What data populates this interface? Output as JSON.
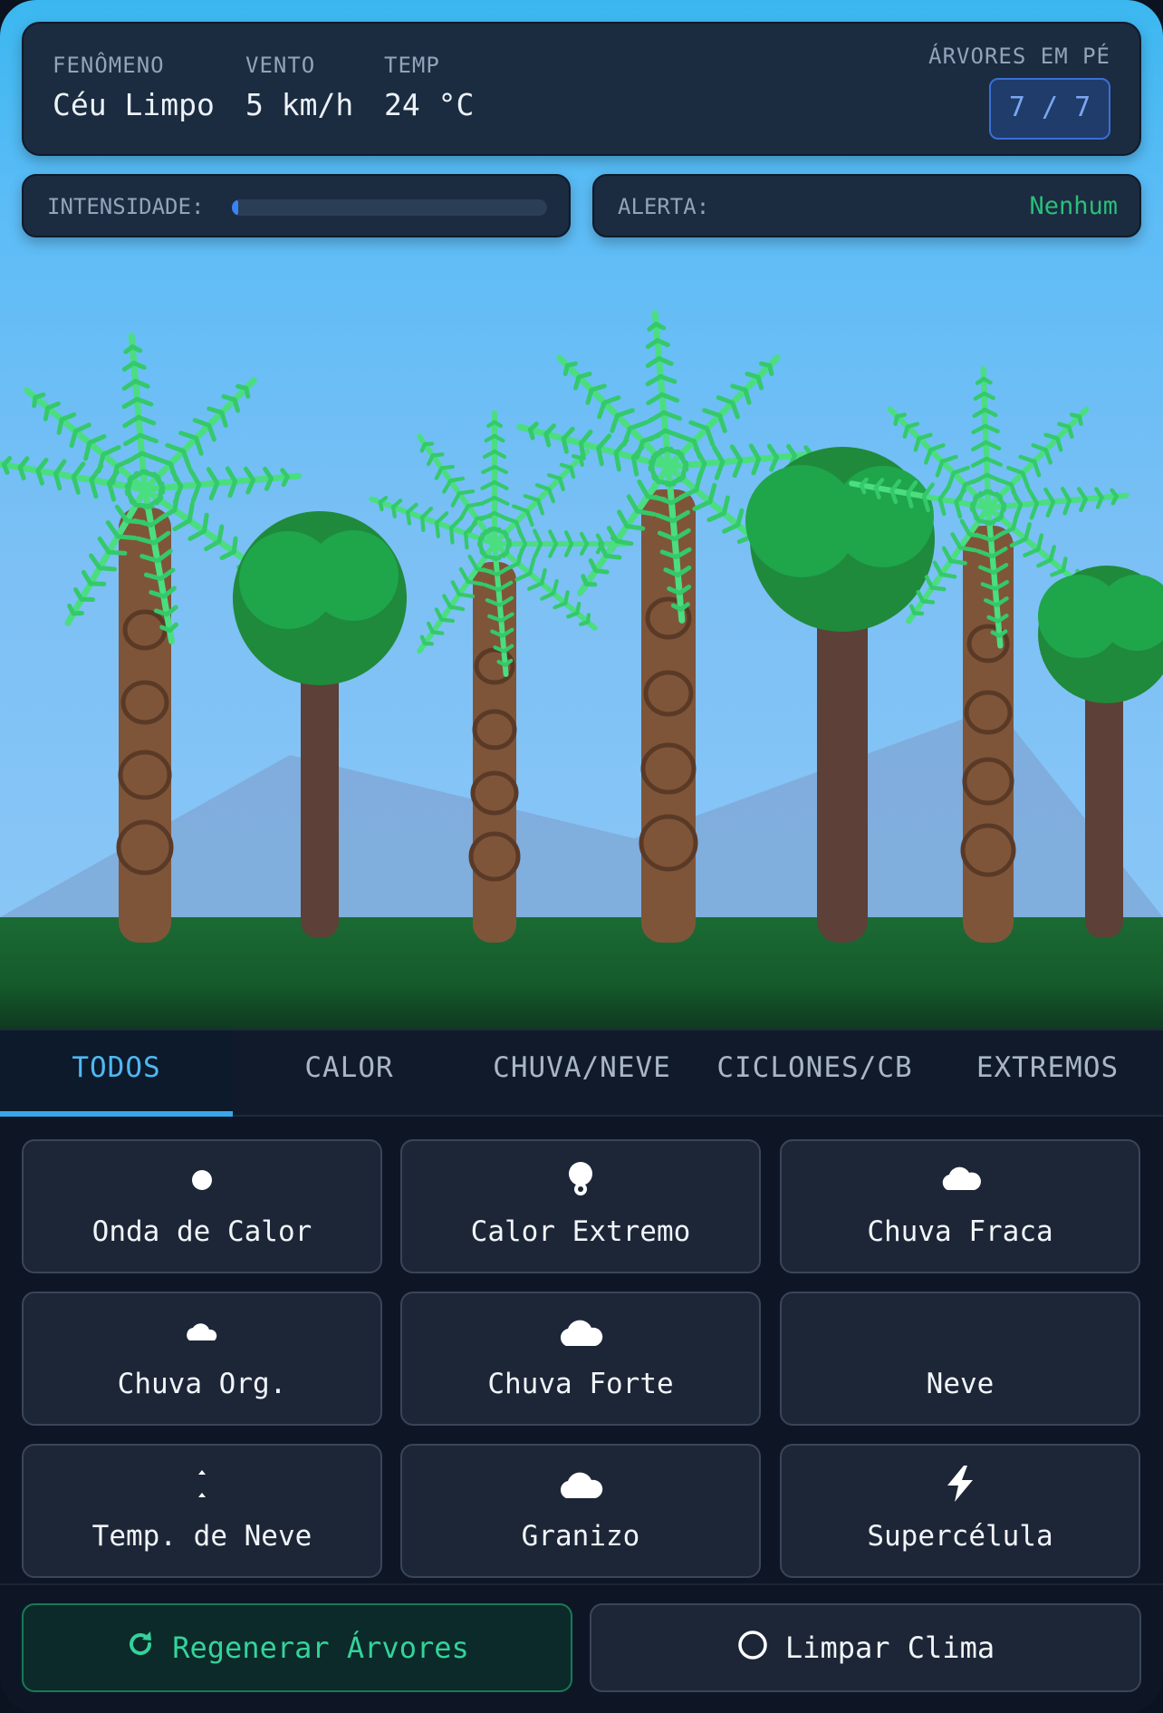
{
  "hud": {
    "fenomeno_label": "FENÔMENO",
    "fenomeno_value": "Céu Limpo",
    "vento_label": "VENTO",
    "vento_value": "5 km/h",
    "temp_label": "TEMP",
    "temp_value": "24 °C",
    "arvores_label": "ÁRVORES EM PÉ",
    "arvores_value": "7 / 7"
  },
  "intensity": {
    "label": "INTENSIDADE:",
    "level": 0.02
  },
  "alert": {
    "label": "ALERTA:",
    "value": "Nenhum"
  },
  "tabs": [
    {
      "label": "TODOS",
      "active": true
    },
    {
      "label": "CALOR",
      "active": false
    },
    {
      "label": "CHUVA/NEVE",
      "active": false
    },
    {
      "label": "CICLONES/CB",
      "active": false
    },
    {
      "label": "EXTREMOS",
      "active": false
    }
  ],
  "phenomena": [
    {
      "label": "Onda de Calor",
      "icon": "sun-dot-icon"
    },
    {
      "label": "Calor Extremo",
      "icon": "thermometer-icon"
    },
    {
      "label": "Chuva Fraca",
      "icon": "cloud-icon"
    },
    {
      "label": "Chuva Org.",
      "icon": "cloud-small-icon"
    },
    {
      "label": "Chuva Forte",
      "icon": "cloud-icon"
    },
    {
      "label": "Neve",
      "icon": ""
    },
    {
      "label": "Temp. de Neve",
      "icon": "snow-icon"
    },
    {
      "label": "Granizo",
      "icon": "cloud-icon"
    },
    {
      "label": "Supercélula",
      "icon": "lightning-icon"
    }
  ],
  "buttons": {
    "regen_label": "Regenerar Árvores",
    "clear_label": "Limpar Clima"
  },
  "colors": {
    "accent_blue": "#38a7ea",
    "accent_green": "#34d399",
    "alert_green": "#2bbf7a",
    "trunk_palm": "#7f5539",
    "trunk_broad": "#5d4037",
    "leaf_palm": "#4ade80",
    "leaf_broad": "#16a34a"
  }
}
